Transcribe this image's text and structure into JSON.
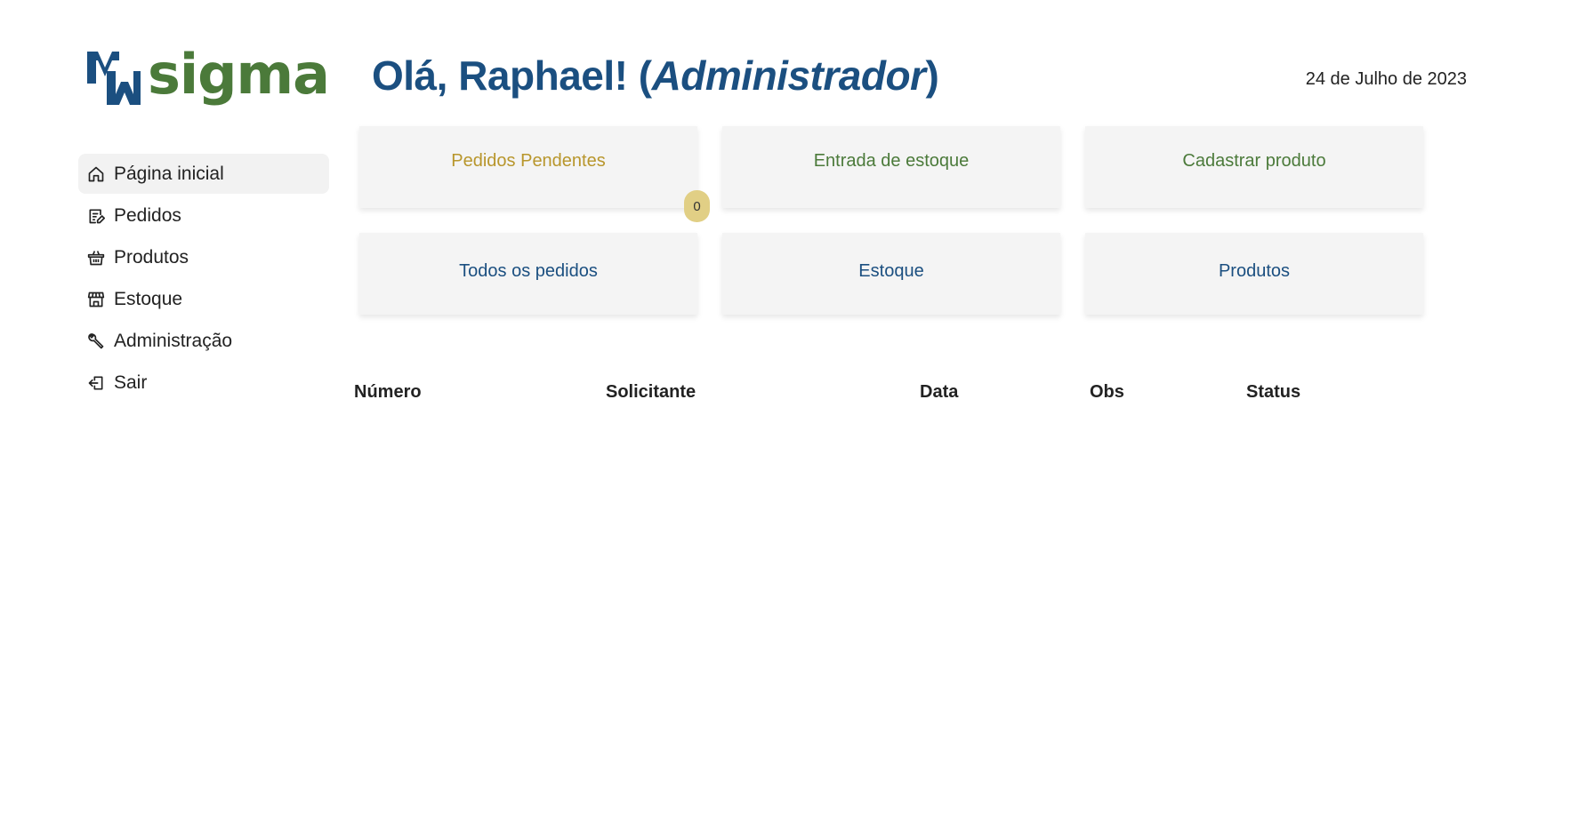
{
  "brand": {
    "name": "sigma",
    "mark_color": "#1b4f80",
    "text_color": "#4b7a3a"
  },
  "header": {
    "greeting_prefix": "Olá, Raphael! (",
    "role": "Administrador",
    "greeting_suffix": ")",
    "date": "24 de Julho de 2023"
  },
  "sidebar": {
    "items": [
      {
        "label": "Página inicial",
        "icon": "home-icon",
        "active": true
      },
      {
        "label": "Pedidos",
        "icon": "edit-list-icon",
        "active": false
      },
      {
        "label": "Produtos",
        "icon": "basket-icon",
        "active": false
      },
      {
        "label": "Estoque",
        "icon": "store-icon",
        "active": false
      },
      {
        "label": "Administração",
        "icon": "wrench-icon",
        "active": false
      },
      {
        "label": "Sair",
        "icon": "logout-icon",
        "active": false
      }
    ]
  },
  "cards": {
    "pending_orders": {
      "label": "Pedidos Pendentes",
      "count": "0"
    },
    "stock_entry": {
      "label": "Entrada de estoque"
    },
    "register_product": {
      "label": "Cadastrar produto"
    },
    "all_orders": {
      "label": "Todos os pedidos"
    },
    "stock": {
      "label": "Estoque"
    },
    "products": {
      "label": "Produtos"
    }
  },
  "table": {
    "columns": [
      "Número",
      "Solicitante",
      "Data",
      "Obs",
      "Status"
    ],
    "rows": []
  },
  "colors": {
    "pending": "#b8962c",
    "green": "#4b7a3a",
    "blue": "#1b4f80",
    "badge": "#e1cf85",
    "card_bg": "#f4f4f4"
  }
}
